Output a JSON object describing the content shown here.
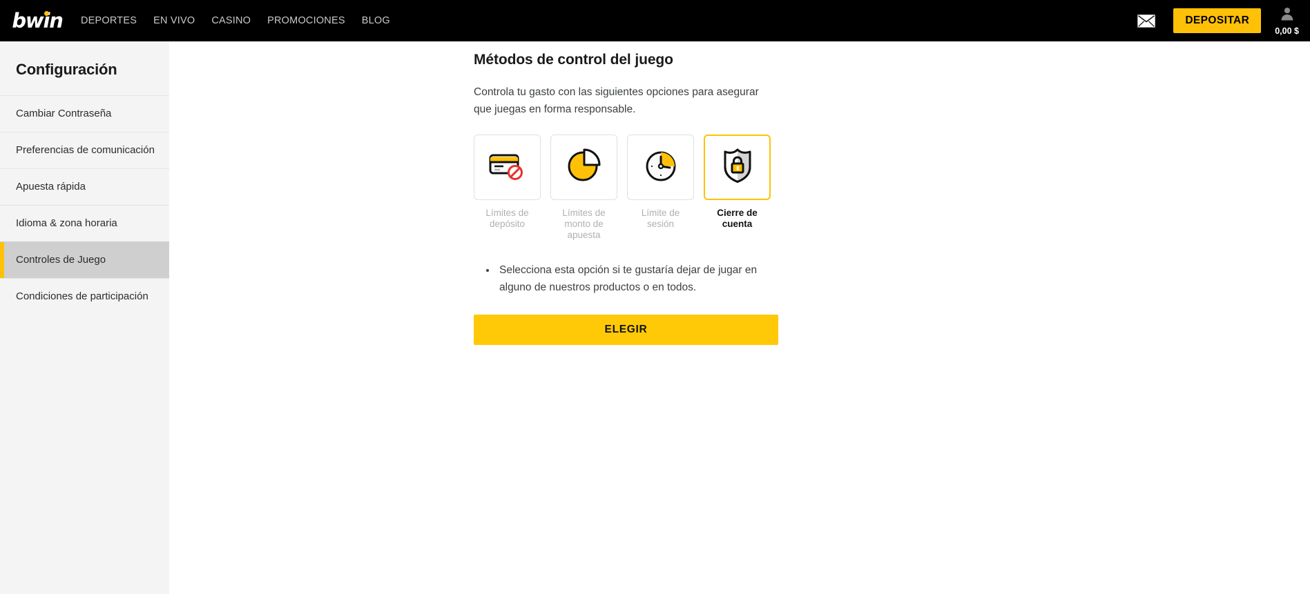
{
  "header": {
    "logo_text": "bwin",
    "logo_dot_color": "#ffc107",
    "nav": [
      {
        "label": "DEPORTES"
      },
      {
        "label": "EN VIVO"
      },
      {
        "label": "CASINO"
      },
      {
        "label": "PROMOCIONES"
      },
      {
        "label": "BLOG"
      }
    ],
    "mail_icon": "envelope-icon",
    "deposit_label": "DEPOSITAR",
    "account_icon": "user-avatar-icon",
    "balance": "0,00 $",
    "accent_color": "#ffc107",
    "background_color": "#000000"
  },
  "sidebar": {
    "title": "Configuración",
    "background_color": "#f4f4f4",
    "active_background_color": "#cfcfcf",
    "active_accent_color": "#ffc107",
    "items": [
      {
        "label": "Cambiar Contraseña",
        "active": false
      },
      {
        "label": "Preferencias de comunicación",
        "active": false
      },
      {
        "label": "Apuesta rápida",
        "active": false
      },
      {
        "label": "Idioma & zona horaria",
        "active": false
      },
      {
        "label": "Controles de Juego",
        "active": true
      },
      {
        "label": "Condiciones de participación",
        "active": false
      }
    ]
  },
  "main": {
    "title": "Métodos de control del juego",
    "description": "Controla tu gasto con las siguientes opciones para asegurar que juegas en forma responsable.",
    "options": [
      {
        "label": "Límites de depósito",
        "icon": "credit-card-blocked-icon",
        "selected": false
      },
      {
        "label": "Límites de monto de apuesta",
        "icon": "pie-chart-icon",
        "selected": false
      },
      {
        "label": "Límite de sesión",
        "icon": "clock-timer-icon",
        "selected": false
      },
      {
        "label": "Cierre de cuenta",
        "icon": "shield-lock-icon",
        "selected": true
      }
    ],
    "bullets": [
      "Selecciona esta opción si te gustaría dejar de jugar en alguno de nuestros productos o en todos."
    ],
    "choose_label": "ELEGIR",
    "choose_button_color": "#ffc907"
  }
}
